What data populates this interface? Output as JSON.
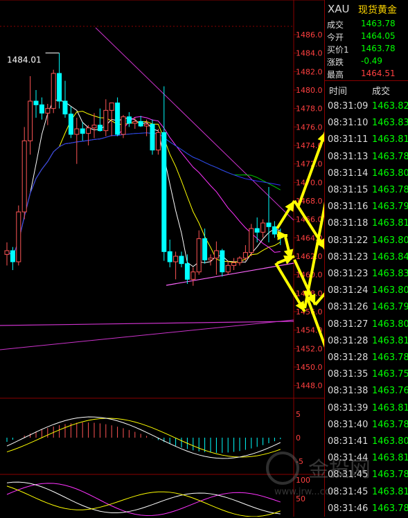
{
  "quote": {
    "symbol": "XAU",
    "name": "现货黄金",
    "rows": [
      {
        "label": "成交",
        "value": "1463.78",
        "color": "#00ff00"
      },
      {
        "label": "今开",
        "value": "1464.05",
        "color": "#00ff00"
      },
      {
        "label": "买价1",
        "value": "1463.78",
        "color": "#00ff00"
      },
      {
        "label": "涨跌",
        "value": "-0.49",
        "color": "#00ff00"
      },
      {
        "label": "最高",
        "value": "1464.51",
        "color": "#ff4040"
      }
    ]
  },
  "ticks": {
    "header_time": "时间",
    "header_price": "成交",
    "rows": [
      {
        "time": "08:31:09",
        "price": "1463.82"
      },
      {
        "time": "08:31:10",
        "price": "1463.83"
      },
      {
        "time": "08:31:11",
        "price": "1463.81"
      },
      {
        "time": "08:31:13",
        "price": "1463.78"
      },
      {
        "time": "08:31:14",
        "price": "1463.80"
      },
      {
        "time": "08:31:15",
        "price": "1463.78"
      },
      {
        "time": "08:31:16",
        "price": "1463.79"
      },
      {
        "time": "08:31:18",
        "price": "1463.81"
      },
      {
        "time": "08:31:22",
        "price": "1463.80"
      },
      {
        "time": "08:31:23",
        "price": "1463.84"
      },
      {
        "time": "08:31:23",
        "price": "1463.83"
      },
      {
        "time": "08:31:24",
        "price": "1463.80"
      },
      {
        "time": "08:31:26",
        "price": "1463.79"
      },
      {
        "time": "08:31:27",
        "price": "1463.80"
      },
      {
        "time": "08:31:28",
        "price": "1463.81"
      },
      {
        "time": "08:31:28",
        "price": "1463.78"
      },
      {
        "time": "08:31:35",
        "price": "1463.75"
      },
      {
        "time": "08:31:38",
        "price": "1463.76"
      },
      {
        "time": "08:31:39",
        "price": "1463.81"
      },
      {
        "time": "08:31:40",
        "price": "1463.78"
      },
      {
        "time": "08:31:41",
        "price": "1463.80"
      },
      {
        "time": "08:31:44",
        "price": "1463.81"
      },
      {
        "time": "08:31:45",
        "price": "1463.78"
      },
      {
        "time": "08:31:45",
        "price": "1463.81"
      },
      {
        "time": "08:31:46",
        "price": "1463.78"
      }
    ]
  },
  "chart_data": {
    "type": "candlestick",
    "high_label": "1484.01",
    "y_ticks": [
      "1486.0",
      "1484.0",
      "1482.0",
      "1480.0",
      "1478.0",
      "1476.0",
      "1474.0",
      "1472.0",
      "1470.0",
      "1468.0",
      "1466.0",
      "1464.0",
      "1462.0",
      "1460.0",
      "1458.0",
      "1456.0",
      "1454.0",
      "1452.0",
      "1450.0",
      "1448.0"
    ],
    "y_range": [
      1447,
      1487.5
    ],
    "candles": [
      [
        1462.2,
        1463.5,
        1461.0,
        1462.6
      ],
      [
        1462.6,
        1463.0,
        1460.5,
        1461.4
      ],
      [
        1461.4,
        1467.5,
        1461.0,
        1466.8
      ],
      [
        1466.8,
        1476.0,
        1466.0,
        1474.5
      ],
      [
        1474.5,
        1481.5,
        1473.0,
        1478.8
      ],
      [
        1478.8,
        1480.0,
        1477.0,
        1478.4
      ],
      [
        1478.4,
        1479.2,
        1476.8,
        1477.5
      ],
      [
        1477.5,
        1478.5,
        1476.2,
        1478.0
      ],
      [
        1478.0,
        1482.2,
        1477.5,
        1481.8
      ],
      [
        1481.8,
        1484.0,
        1478.0,
        1478.8
      ],
      [
        1478.8,
        1481.0,
        1477.0,
        1477.4
      ],
      [
        1477.4,
        1478.2,
        1474.8,
        1475.2
      ],
      [
        1475.2,
        1477.0,
        1472.0,
        1475.8
      ],
      [
        1475.8,
        1476.5,
        1474.5,
        1475.3
      ],
      [
        1475.3,
        1476.2,
        1474.0,
        1475.9
      ],
      [
        1475.9,
        1477.5,
        1474.8,
        1476.2
      ],
      [
        1476.2,
        1478.0,
        1475.5,
        1475.6
      ],
      [
        1475.6,
        1479.0,
        1475.0,
        1477.8
      ],
      [
        1477.8,
        1478.5,
        1475.0,
        1478.6
      ],
      [
        1478.6,
        1479.2,
        1475.0,
        1475.2
      ],
      [
        1475.2,
        1477.3,
        1474.8,
        1477.1
      ],
      [
        1477.1,
        1477.6,
        1476.0,
        1476.4
      ],
      [
        1476.4,
        1477.0,
        1475.8,
        1476.6
      ],
      [
        1476.6,
        1477.2,
        1476.0,
        1476.1
      ],
      [
        1476.1,
        1476.8,
        1475.0,
        1476.3
      ],
      [
        1476.3,
        1476.8,
        1473.0,
        1473.5
      ],
      [
        1473.5,
        1475.8,
        1473.0,
        1475.4
      ],
      [
        1475.4,
        1480.4,
        1461.5,
        1462.5
      ],
      [
        1462.5,
        1463.8,
        1460.8,
        1461.4
      ],
      [
        1461.4,
        1462.5,
        1459.5,
        1462.0
      ],
      [
        1462.0,
        1462.5,
        1460.8,
        1461.2
      ],
      [
        1461.2,
        1462.2,
        1459.0,
        1459.5
      ],
      [
        1459.5,
        1460.8,
        1458.8,
        1460.3
      ],
      [
        1460.3,
        1464.8,
        1460.0,
        1463.9
      ],
      [
        1463.9,
        1465.0,
        1461.2,
        1461.6
      ],
      [
        1461.6,
        1462.2,
        1461.0,
        1461.8
      ],
      [
        1461.8,
        1463.6,
        1460.0,
        1462.6
      ],
      [
        1462.6,
        1462.8,
        1459.8,
        1460.3
      ],
      [
        1460.3,
        1461.5,
        1460.0,
        1461.0
      ],
      [
        1461.0,
        1461.8,
        1460.5,
        1461.3
      ],
      [
        1461.3,
        1462.0,
        1461.0,
        1461.8
      ],
      [
        1461.8,
        1463.2,
        1461.5,
        1462.4
      ],
      [
        1462.4,
        1465.5,
        1462.0,
        1465.0
      ],
      [
        1465.0,
        1466.2,
        1463.5,
        1464.6
      ],
      [
        1464.6,
        1466.0,
        1464.0,
        1465.6
      ],
      [
        1465.6,
        1469.5,
        1463.5,
        1465.2
      ],
      [
        1465.2,
        1465.8,
        1464.0,
        1464.4
      ],
      [
        1464.4,
        1465.0,
        1463.2,
        1464.0
      ]
    ],
    "macd_ticks": [
      "5",
      "0",
      "-5"
    ],
    "kdj_ticks": [
      "100",
      "50"
    ],
    "colors": {
      "up": "#ff5555",
      "down": "#00ffff",
      "grid": "#8b0000",
      "axis_text": "#ff4040",
      "arrow": "#ffff00"
    }
  },
  "watermark": {
    "text": "金投网",
    "url": "www.jrw...com"
  }
}
